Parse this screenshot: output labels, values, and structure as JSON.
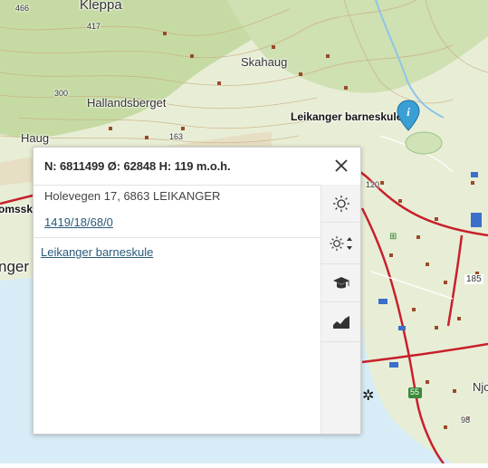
{
  "map": {
    "labels": [
      {
        "id": "kleppa",
        "text": "Kleppa"
      },
      {
        "id": "h466",
        "text": "466"
      },
      {
        "id": "h417",
        "text": "417"
      },
      {
        "id": "skahaug",
        "text": "Skahaug"
      },
      {
        "id": "h300",
        "text": "300"
      },
      {
        "id": "hallandsberget",
        "text": "Hallandsberget"
      },
      {
        "id": "haug",
        "text": "Haug"
      },
      {
        "id": "h163",
        "text": "163"
      },
      {
        "id": "school",
        "text": "Leikanger barneskule"
      },
      {
        "id": "h120",
        "text": "120"
      },
      {
        "id": "omssk",
        "text": "omssk"
      },
      {
        "id": "nger",
        "text": "nger"
      },
      {
        "id": "r185",
        "text": "185"
      },
      {
        "id": "r55",
        "text": "55"
      },
      {
        "id": "njo",
        "text": "Njo"
      },
      {
        "id": "h98",
        "text": "98"
      }
    ],
    "marker_icon": "info-pin-icon"
  },
  "popup": {
    "title": "N: 6811499 Ø: 62848 H: 119 m.o.h.",
    "address": "Holevegen 17, 6863 LEIKANGER",
    "cadastre": "1419/18/68/0",
    "place_link": "Leikanger barneskule",
    "tools": [
      {
        "icon": "sun-icon"
      },
      {
        "icon": "sun-adjust-icon"
      },
      {
        "icon": "graduation-cap-icon"
      },
      {
        "icon": "elevation-profile-icon"
      }
    ]
  },
  "colors": {
    "terrain": "#e6ecd2",
    "forest": "#c9dca8",
    "water": "#d7ecf7",
    "road": "#c8202b",
    "marker": "#3a9fd4"
  }
}
